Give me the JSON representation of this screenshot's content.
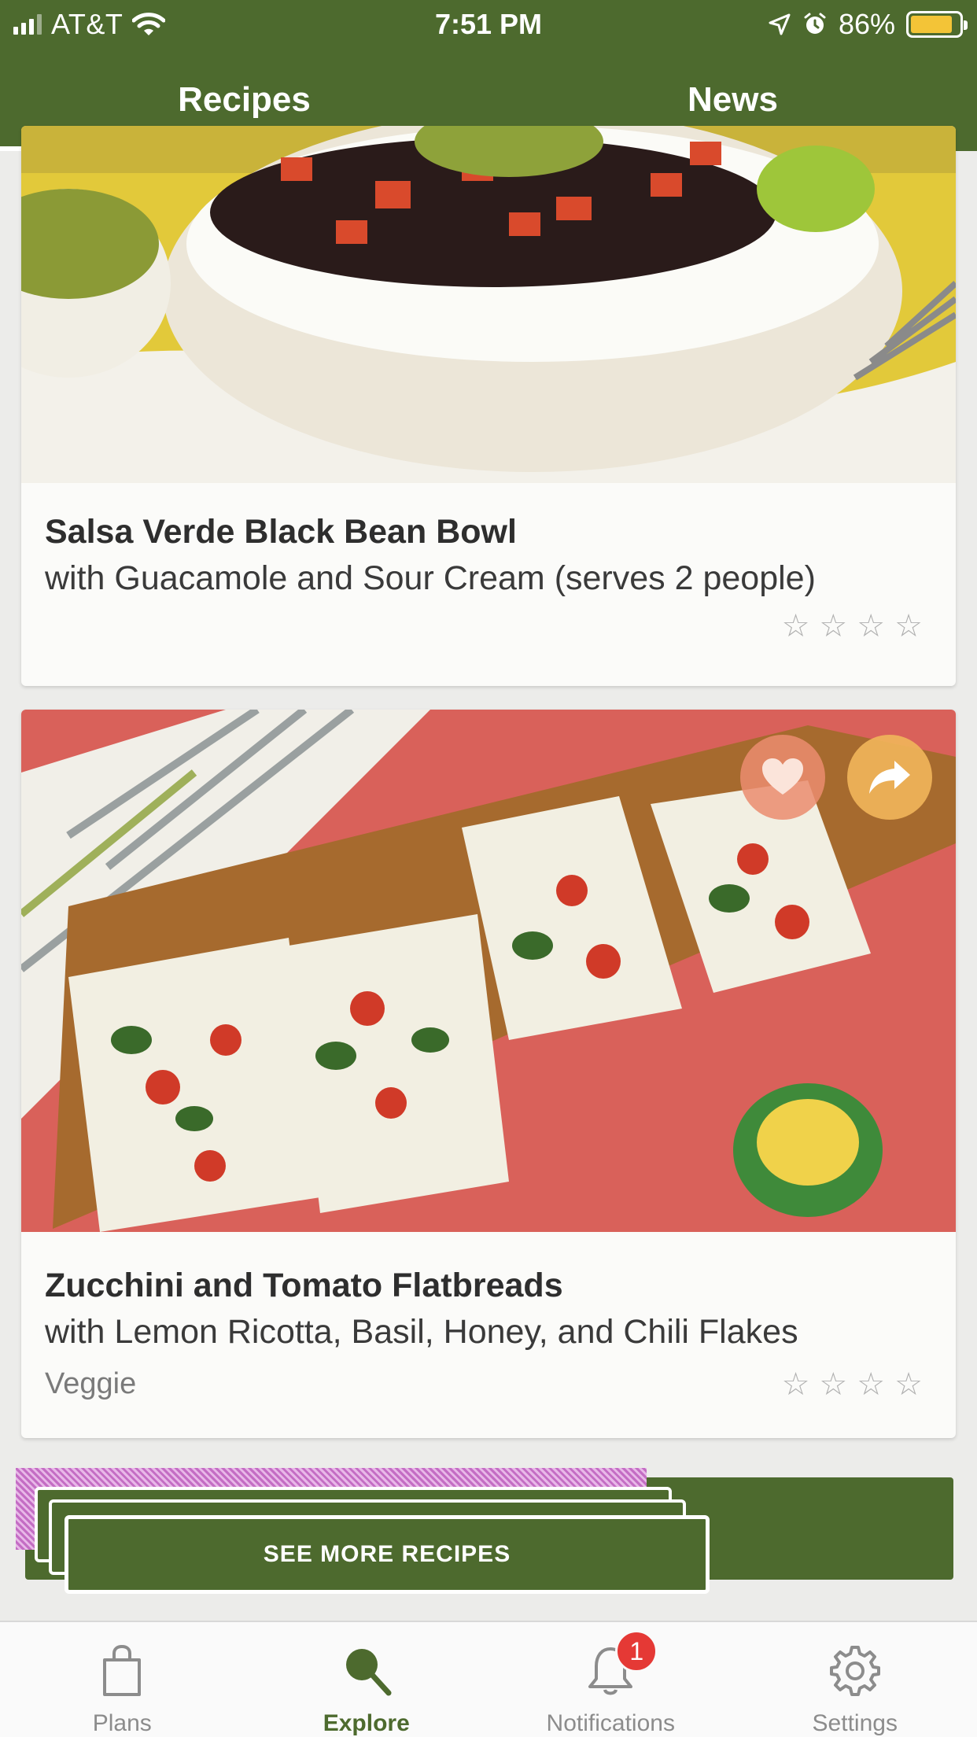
{
  "status_bar": {
    "carrier": "AT&T",
    "time": "7:51 PM",
    "battery_percent": "86%",
    "battery_level": 0.86
  },
  "tabs": [
    {
      "label": "Recipes",
      "active": true
    },
    {
      "label": "News",
      "active": false
    }
  ],
  "recipes": [
    {
      "title": "Salsa Verde Black Bean Bowl",
      "subtitle": "with Guacamole and Sour Cream (serves 2 people)",
      "tag": "",
      "rating": 0,
      "max_rating": 4,
      "image_icon": "food-photo-bean-bowl"
    },
    {
      "title": "Zucchini and Tomato Flatbreads",
      "subtitle": "with Lemon Ricotta, Basil, Honey, and Chili Flakes",
      "tag": "Veggie",
      "rating": 0,
      "max_rating": 4,
      "image_icon": "food-photo-flatbreads"
    }
  ],
  "see_more": {
    "label": "SEE MORE RECIPES"
  },
  "bottom_nav": [
    {
      "label": "Plans",
      "icon": "shopping-bag-icon",
      "active": false
    },
    {
      "label": "Explore",
      "icon": "search-icon",
      "active": true
    },
    {
      "label": "Notifications",
      "icon": "bell-icon",
      "active": false,
      "badge": "1"
    },
    {
      "label": "Settings",
      "icon": "gear-icon",
      "active": false
    }
  ],
  "colors": {
    "brand_green": "#4d6a2e",
    "badge_red": "#e53935",
    "battery_yellow": "#f3c437",
    "favorite_bg": "#eb8c6e",
    "share_bg": "#f0b45a"
  }
}
